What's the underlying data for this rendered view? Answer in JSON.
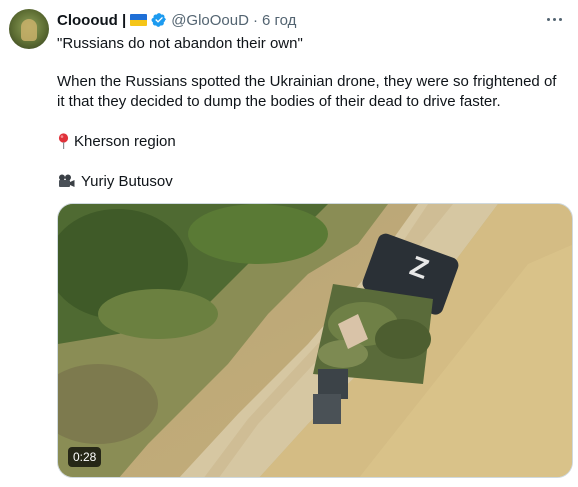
{
  "tweet": {
    "display_name": "Cloooud |",
    "handle": "@GloOouD",
    "dot": "·",
    "time": "6 год",
    "quote": "\"Russians do not abandon their own\"",
    "body": "When the Russians spotted the Ukrainian drone, they were so frightened of it that they decided to dump the bodies of their dead to drive faster.",
    "location": "Kherson region",
    "credit": "Yuriy Butusov",
    "video_duration": "0:28"
  },
  "colors": {
    "text": "#0f1419",
    "muted": "#536471",
    "verified": "#1d9bf0",
    "flag_blue": "#1f6fd6",
    "flag_yellow": "#f5c518"
  },
  "icons": {
    "more": "more-options-icon",
    "verified": "verified-badge-icon",
    "flag": "ukraine-flag-icon",
    "location": "round-pushpin-icon",
    "credit": "movie-camera-icon"
  }
}
